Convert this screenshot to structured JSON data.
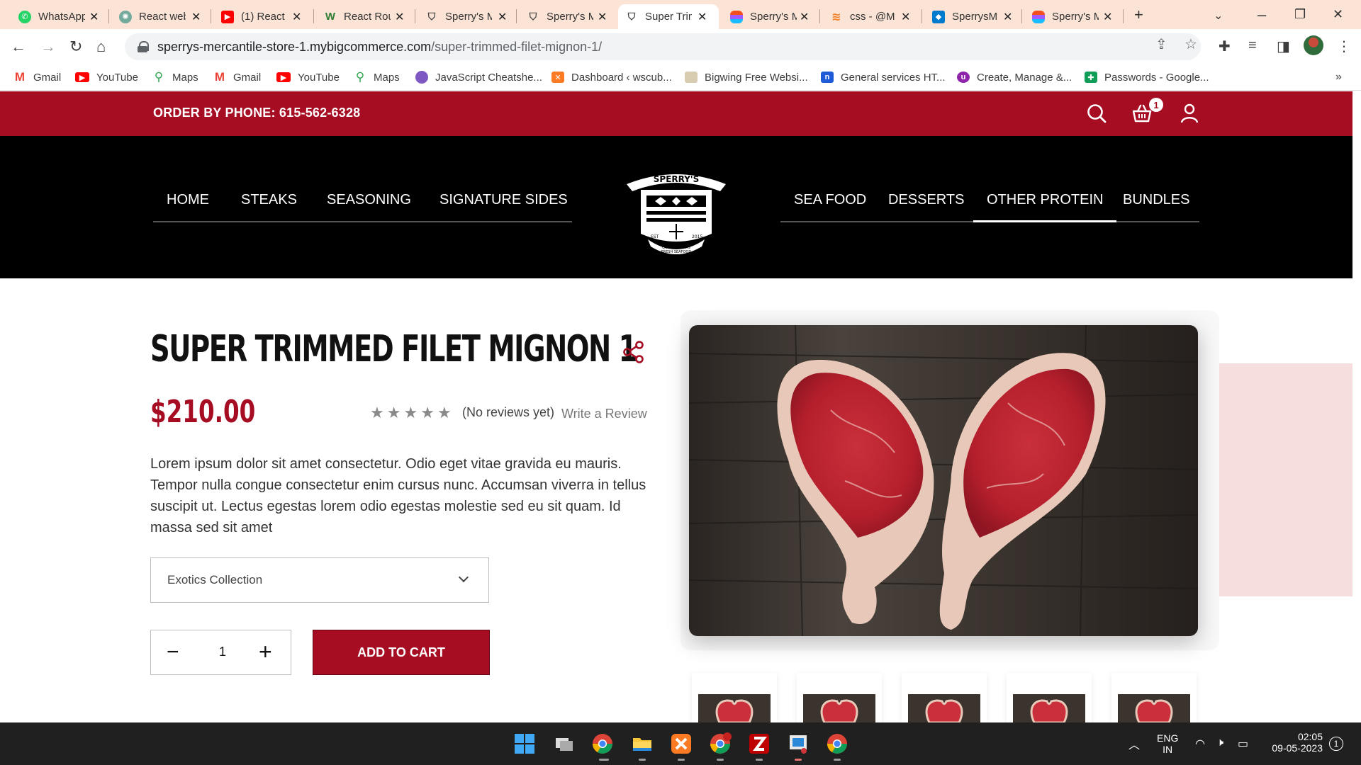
{
  "browser": {
    "tabs": [
      {
        "title": "WhatsApp",
        "icon": "whatsapp-icon",
        "color": "#25d366"
      },
      {
        "title": "React web",
        "icon": "chatgpt-icon",
        "color": "#74aa9c"
      },
      {
        "title": "(1) React",
        "icon": "youtube-icon",
        "color": "#ff0000"
      },
      {
        "title": "React Rou",
        "icon": "w-icon",
        "color": "#ffffff"
      },
      {
        "title": "Sperry's M",
        "icon": "sperrys-icon",
        "color": "#ffffff"
      },
      {
        "title": "Sperry's M",
        "icon": "sperrys-icon",
        "color": "#ffffff"
      },
      {
        "title": "Super Trim",
        "icon": "sperrys-icon",
        "color": "#ffffff",
        "active": true
      },
      {
        "title": "Sperry's M",
        "icon": "figma-icon",
        "color": "#f24e1e"
      },
      {
        "title": "css - @M",
        "icon": "stackoverflow-icon",
        "color": "#f48024"
      },
      {
        "title": "SperrysM",
        "icon": "vscode-icon",
        "color": "#007acc"
      },
      {
        "title": "Sperry's M",
        "icon": "figma-icon",
        "color": "#f24e1e"
      }
    ],
    "url_domain": "sperrys-mercantile-store-1.mybigcommerce.com",
    "url_path": "/super-trimmed-filet-mignon-1/",
    "bookmarks": [
      {
        "label": "Gmail",
        "icon": "gmail-icon"
      },
      {
        "label": "YouTube",
        "icon": "youtube-icon"
      },
      {
        "label": "Maps",
        "icon": "maps-icon"
      },
      {
        "label": "Gmail",
        "icon": "gmail-icon"
      },
      {
        "label": "YouTube",
        "icon": "youtube-icon"
      },
      {
        "label": "Maps",
        "icon": "maps-icon"
      },
      {
        "label": "JavaScript Cheatshe...",
        "icon": "avatar-icon"
      },
      {
        "label": "Dashboard ‹ wscub...",
        "icon": "xampp-icon"
      },
      {
        "label": "Bigwing Free Websi...",
        "icon": "page-icon"
      },
      {
        "label": "General services HT...",
        "icon": "n-icon"
      },
      {
        "label": "Create, Manage &...",
        "icon": "u-icon"
      },
      {
        "label": "Passwords - Google...",
        "icon": "sheets-icon"
      }
    ]
  },
  "site": {
    "phone": "ORDER BY PHONE: 615-562-6328",
    "cart_count": "1",
    "nav_left": [
      "HOME",
      "STEAKS",
      "SEASONING",
      "SIGNATURE SIDES"
    ],
    "nav_right": [
      "SEA FOOD",
      "DESSERTS",
      "OTHER PROTEIN",
      "BUNDLES"
    ],
    "active_nav": "OTHER PROTEIN",
    "logo_text": {
      "top": "SPERRY'S",
      "sub": "MERCANTILE",
      "est": "EST",
      "year": "2015",
      "tagline1": "QUALITY MEATS",
      "tagline2": "FRESH SEAFOOD"
    },
    "brand_color": "#a60c22"
  },
  "product": {
    "title": "SUPER TRIMMED FILET MIGNON 1",
    "price": "$210.00",
    "rating_stars": 5,
    "reviews_text": "(No reviews yet)",
    "write_review": "Write a Review",
    "description": "Lorem ipsum dolor sit amet consectetur. Odio eget vitae gravida eu mauris. Tempor nulla congue consectetur enim cursus nunc. Accumsan viverra in tellus suscipit ut. Lectus egestas lorem odio egestas molestie sed eu sit quam. Id massa sed sit amet",
    "option_selected": "Exotics Collection",
    "quantity": "1",
    "add_to_cart": "ADD TO CART",
    "thumbnail_count": 5
  },
  "taskbar": {
    "lang_top": "ENG",
    "lang_bottom": "IN",
    "time": "02:05",
    "date": "09-05-2023",
    "notification_count": "1"
  }
}
